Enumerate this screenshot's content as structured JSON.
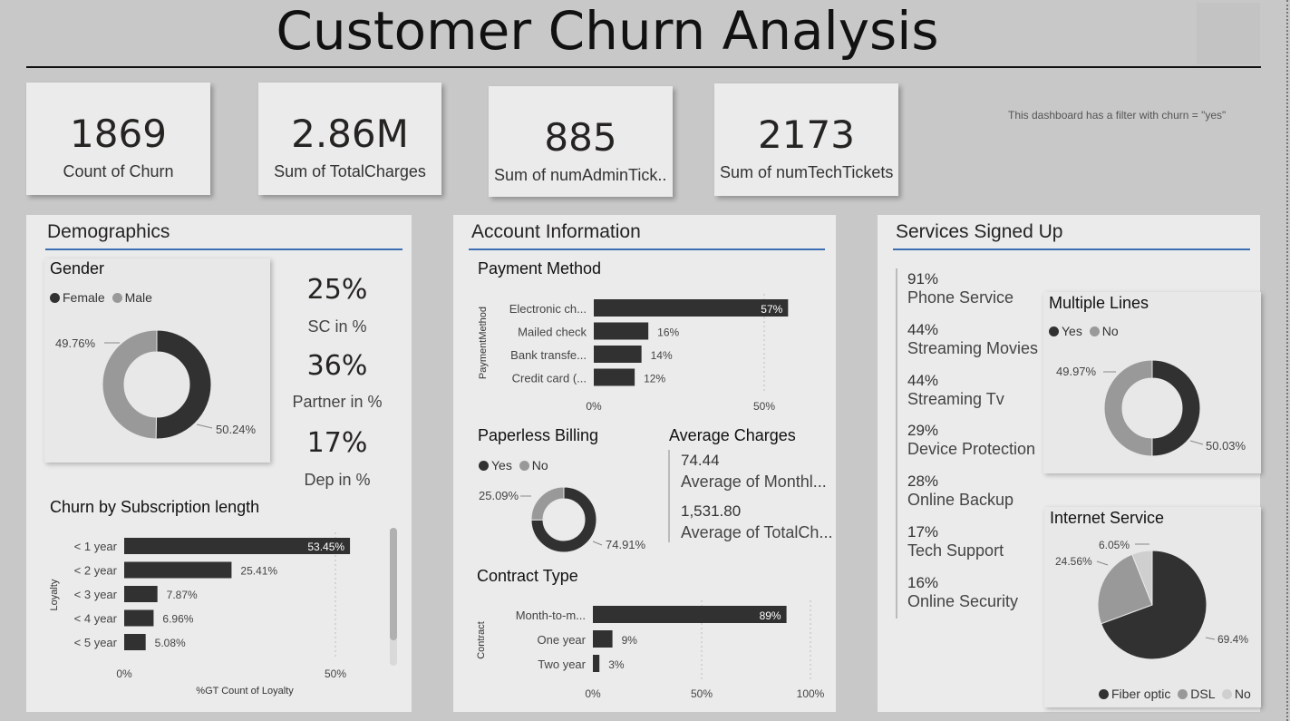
{
  "title": "Customer Churn Analysis",
  "note": "This dashboard has a filter with churn = \"yes\"",
  "kpis": [
    {
      "value": "1869",
      "label": "Count of Churn"
    },
    {
      "value": "2.86M",
      "label": "Sum of TotalCharges"
    },
    {
      "value": "885",
      "label": "Sum of numAdminTick..."
    },
    {
      "value": "2173",
      "label": "Sum of numTechTickets"
    }
  ],
  "colors": {
    "dark": "#313131",
    "mid": "#999999",
    "light": "#cfcfcf",
    "accent_rule": "#3e6fb3"
  },
  "demographics": {
    "title": "Demographics",
    "gender": {
      "title": "Gender",
      "legend": [
        "Female",
        "Male"
      ],
      "slices": [
        {
          "name": "Female",
          "pct": 50.24,
          "label": "50.24%"
        },
        {
          "name": "Male",
          "pct": 49.76,
          "label": "49.76%"
        }
      ]
    },
    "cards": [
      {
        "value": "25%",
        "label": "SC in %"
      },
      {
        "value": "36%",
        "label": "Partner in %"
      },
      {
        "value": "17%",
        "label": "Dep in %"
      }
    ],
    "subscription": {
      "title": "Churn by Subscription length",
      "ylabel": "Loyalty",
      "xlabel": "%GT Count of Loyalty",
      "ticks": [
        "0%",
        "50%"
      ],
      "bars": [
        {
          "cat": "< 1 year",
          "value": 53.45,
          "label": "53.45%"
        },
        {
          "cat": "< 2 year",
          "value": 25.41,
          "label": "25.41%"
        },
        {
          "cat": "< 3 year",
          "value": 7.87,
          "label": "7.87%"
        },
        {
          "cat": "< 4 year",
          "value": 6.96,
          "label": "6.96%"
        },
        {
          "cat": "< 5 year",
          "value": 5.08,
          "label": "5.08%"
        }
      ]
    }
  },
  "account": {
    "title": "Account Information",
    "payment": {
      "title": "Payment Method",
      "ylabel": "PaymentMethod",
      "ticks": [
        "0%",
        "50%"
      ],
      "bars": [
        {
          "cat": "Electronic ch...",
          "value": 57,
          "label": "57%"
        },
        {
          "cat": "Mailed check",
          "value": 16,
          "label": "16%"
        },
        {
          "cat": "Bank transfe...",
          "value": 14,
          "label": "14%"
        },
        {
          "cat": "Credit card (...",
          "value": 12,
          "label": "12%"
        }
      ]
    },
    "paperless": {
      "title": "Paperless Billing",
      "legend": [
        "Yes",
        "No"
      ],
      "slices": [
        {
          "name": "Yes",
          "pct": 74.91,
          "label": "74.91%"
        },
        {
          "name": "No",
          "pct": 25.09,
          "label": "25.09%"
        }
      ]
    },
    "avg": {
      "title": "Average Charges",
      "items": [
        {
          "value": "74.44",
          "label": "Average of Monthl..."
        },
        {
          "value": "1,531.80",
          "label": "Average of TotalCh..."
        }
      ]
    },
    "contract": {
      "title": "Contract Type",
      "ylabel": "Contract",
      "ticks": [
        "0%",
        "50%",
        "100%"
      ],
      "bars": [
        {
          "cat": "Month-to-m...",
          "value": 89,
          "label": "89%"
        },
        {
          "cat": "One year",
          "value": 9,
          "label": "9%"
        },
        {
          "cat": "Two year",
          "value": 3,
          "label": "3%"
        }
      ]
    }
  },
  "services": {
    "title": "Services Signed Up",
    "items": [
      {
        "value": "91%",
        "label": "Phone Service"
      },
      {
        "value": "44%",
        "label": "Streaming Movies"
      },
      {
        "value": "44%",
        "label": "Streaming Tv"
      },
      {
        "value": "29%",
        "label": "Device Protection"
      },
      {
        "value": "28%",
        "label": "Online Backup"
      },
      {
        "value": "17%",
        "label": "Tech Support"
      },
      {
        "value": "16%",
        "label": "Online Security"
      }
    ],
    "multiple_lines": {
      "title": "Multiple Lines",
      "legend": [
        "Yes",
        "No"
      ],
      "slices": [
        {
          "name": "Yes",
          "pct": 50.03,
          "label": "50.03%"
        },
        {
          "name": "No",
          "pct": 49.97,
          "label": "49.97%"
        }
      ]
    },
    "internet": {
      "title": "Internet Service",
      "legend": [
        "Fiber optic",
        "DSL",
        "No"
      ],
      "slices": [
        {
          "name": "Fiber optic",
          "pct": 69.4,
          "label": "69.4%"
        },
        {
          "name": "DSL",
          "pct": 24.56,
          "label": "24.56%"
        },
        {
          "name": "No",
          "pct": 6.05,
          "label": "6.05%"
        }
      ]
    }
  },
  "chart_data": [
    {
      "type": "pie",
      "title": "Gender",
      "categories": [
        "Female",
        "Male"
      ],
      "values": [
        50.24,
        49.76
      ]
    },
    {
      "type": "bar",
      "title": "Churn by Subscription length",
      "xlabel": "%GT Count of Loyalty",
      "ylabel": "Loyalty",
      "categories": [
        "< 1 year",
        "< 2 year",
        "< 3 year",
        "< 4 year",
        "< 5 year"
      ],
      "values": [
        53.45,
        25.41,
        7.87,
        6.96,
        5.08
      ]
    },
    {
      "type": "bar",
      "title": "Payment Method",
      "ylabel": "PaymentMethod",
      "categories": [
        "Electronic ch...",
        "Mailed check",
        "Bank transfe...",
        "Credit card (..."
      ],
      "values": [
        57,
        16,
        14,
        12
      ]
    },
    {
      "type": "pie",
      "title": "Paperless Billing",
      "categories": [
        "Yes",
        "No"
      ],
      "values": [
        74.91,
        25.09
      ]
    },
    {
      "type": "bar",
      "title": "Contract Type",
      "ylabel": "Contract",
      "categories": [
        "Month-to-m...",
        "One year",
        "Two year"
      ],
      "values": [
        89,
        9,
        3
      ]
    },
    {
      "type": "pie",
      "title": "Multiple Lines",
      "categories": [
        "Yes",
        "No"
      ],
      "values": [
        50.03,
        49.97
      ]
    },
    {
      "type": "pie",
      "title": "Internet Service",
      "categories": [
        "Fiber optic",
        "DSL",
        "No"
      ],
      "values": [
        69.4,
        24.56,
        6.05
      ]
    }
  ]
}
